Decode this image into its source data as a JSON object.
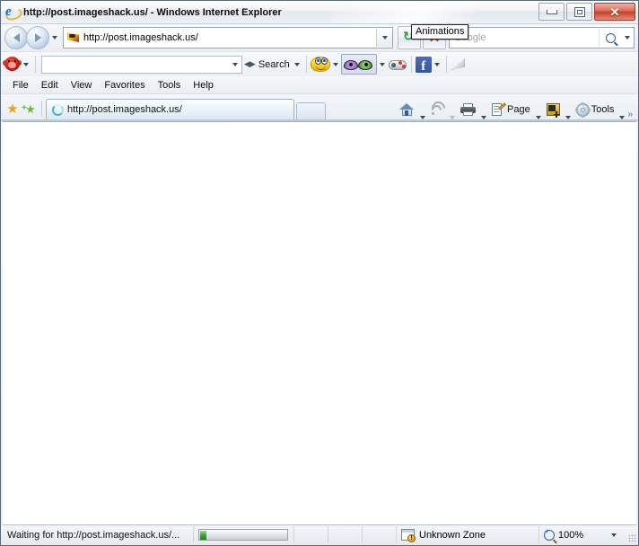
{
  "window": {
    "title": "http://post.imageshack.us/ - Windows Internet Explorer",
    "app_icon": "internet-explorer-icon",
    "buttons": {
      "minimize": "minimize-button",
      "restore": "restore-button",
      "close_label": "✕"
    }
  },
  "address_bar": {
    "back_label": "Back",
    "forward_label": "Forward",
    "history_dropdown_label": "Recent Pages",
    "favicon": "imageshack-favicon",
    "url": "http://post.imageshack.us/",
    "refresh_label": "Refresh",
    "stop_label": "✕",
    "search": {
      "placeholder": "Google",
      "go_label": "Search",
      "provider_dropdown_label": "Search Options"
    }
  },
  "ext_toolbar": {
    "brand_icon": "monkey-face-icon",
    "brand_dropdown_label": "▾",
    "search_input_value": "",
    "search_button_label": "Search",
    "smileys_label": "Smileys",
    "animations_label": "Animations",
    "games_label": "Games",
    "facebook_label": "Facebook",
    "extra_label": "Cursors",
    "tooltip": "Animations"
  },
  "menu_bar": {
    "items": [
      {
        "label": "File"
      },
      {
        "label": "Edit"
      },
      {
        "label": "View"
      },
      {
        "label": "Favorites"
      },
      {
        "label": "Tools"
      },
      {
        "label": "Help"
      }
    ]
  },
  "tab_bar": {
    "favorites_center_label": "Favorites Center",
    "add_favorites_label": "Add to Favorites",
    "tabs": [
      {
        "title": "http://post.imageshack.us/",
        "icon": "loading-spinner-icon",
        "active": true
      }
    ],
    "new_tab_label": "New Tab"
  },
  "command_bar": {
    "home_label": "Home",
    "feeds_label": "Feeds",
    "print_label": "Print",
    "page_label": "Page",
    "safety_label": "Safety",
    "tools_label": "Tools",
    "overflow_label": "»"
  },
  "status_bar": {
    "status_text": "Waiting for http://post.imageshack.us/...",
    "progress_percent": 7,
    "zone_icon": "security-zone-icon",
    "zone_label": "Unknown Zone",
    "zoom_label": "100%",
    "zoom_dropdown_label": "▾"
  },
  "colors": {
    "accent_blue": "#2a5fa8",
    "close_red": "#c2412c",
    "progress_green": "#2fad2f",
    "favorite_orange": "#e8a31c",
    "add_favorite_green": "#6fb836",
    "facebook_blue": "#35569b"
  }
}
